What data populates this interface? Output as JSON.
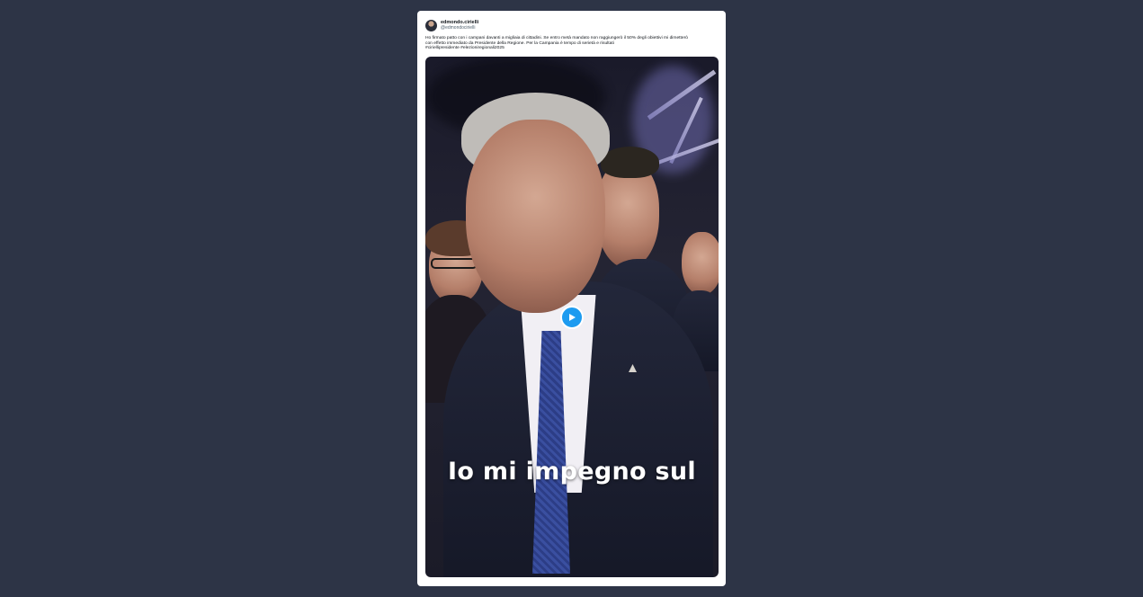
{
  "tweet": {
    "author": {
      "display_name": "edmondo.cirielli",
      "handle": "@edmondocirielli"
    },
    "text_lines": [
      "Ho firmato patto con i campani davanti a migliaia di cittadini. Se entro metà mandato non raggiungerò il 50% degli obiettivi mi dimetterò",
      "con effetto immediato da Presidente della Regione. Per la Campania è tempo di serietà e risultati",
      "#ciriellipresidente #elezioniregionali2025"
    ],
    "video": {
      "caption": "Io mi impegno sul",
      "play_icon": "play-icon"
    }
  },
  "colors": {
    "page_background": "#2d3446",
    "card_background": "#ffffff",
    "play_button": "#1d9bf0"
  }
}
